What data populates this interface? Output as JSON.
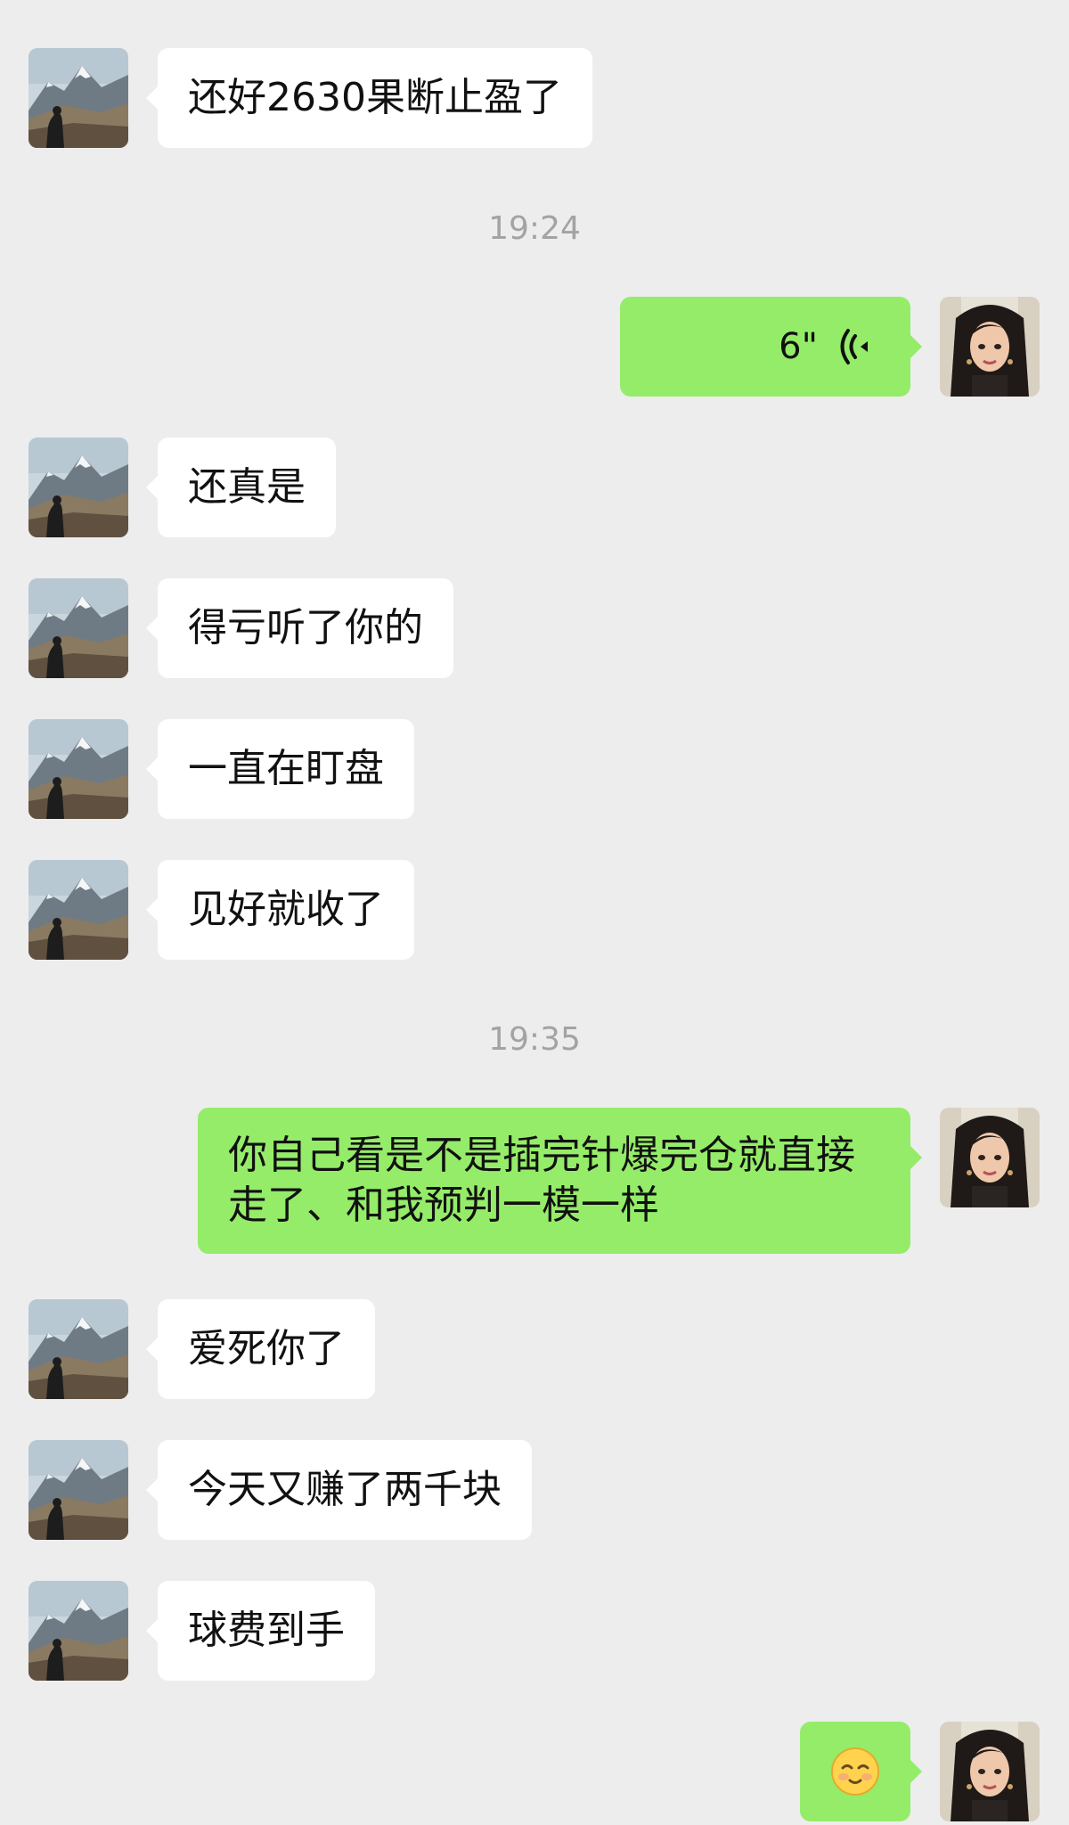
{
  "colors": {
    "background": "#ededed",
    "incoming_bubble": "#ffffff",
    "outgoing_bubble": "#95ec69",
    "timestamp_text": "#a3a3a3"
  },
  "chat": {
    "messages": [
      {
        "id": "msg1",
        "sender": "other",
        "text": "还好2630果断止盈了"
      },
      {
        "id": "ts1",
        "type": "timestamp",
        "text": "19:24"
      },
      {
        "id": "msg2",
        "sender": "me",
        "type": "voice",
        "duration": "6\"",
        "icon": "voice-wave-icon"
      },
      {
        "id": "msg3",
        "sender": "other",
        "text": "还真是"
      },
      {
        "id": "msg4",
        "sender": "other",
        "text": "得亏听了你的"
      },
      {
        "id": "msg5",
        "sender": "other",
        "text": "一直在盯盘"
      },
      {
        "id": "msg6",
        "sender": "other",
        "text": "见好就收了"
      },
      {
        "id": "ts2",
        "type": "timestamp",
        "text": "19:35"
      },
      {
        "id": "msg7",
        "sender": "me",
        "text": "你自己看是不是插完针爆完仓就直接走了、和我预判一模一样"
      },
      {
        "id": "msg8",
        "sender": "other",
        "text": "爱死你了"
      },
      {
        "id": "msg9",
        "sender": "other",
        "text": "今天又赚了两千块"
      },
      {
        "id": "msg10",
        "sender": "other",
        "text": "球费到手"
      },
      {
        "id": "msg11",
        "sender": "me",
        "type": "emoji",
        "emoji": "shy-smile-emoji"
      }
    ]
  }
}
